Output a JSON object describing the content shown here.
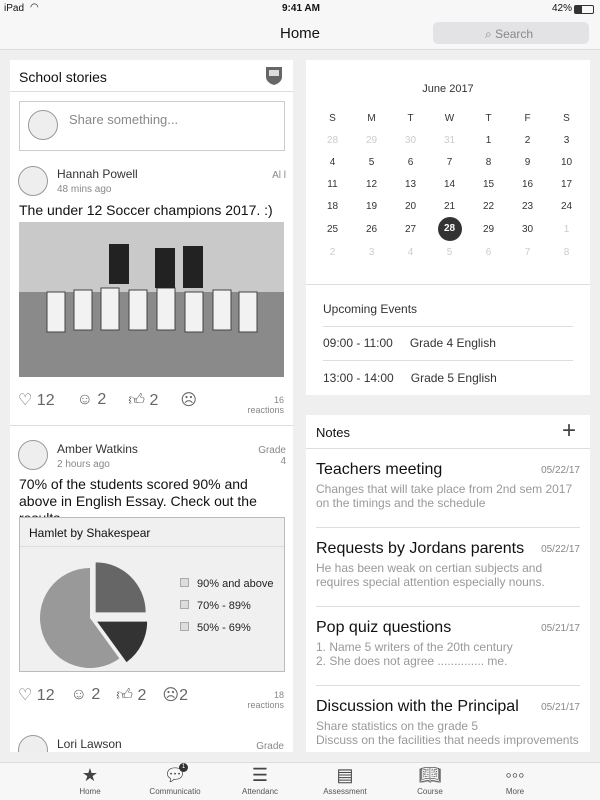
{
  "status": {
    "device": "iPad",
    "time": "9:41 AM",
    "battery": "42%"
  },
  "nav": {
    "title": "Home",
    "search_placeholder": "Search"
  },
  "stories": {
    "title": "School stories",
    "share_placeholder": "Share something...",
    "posts": [
      {
        "author": "Hannah Powell",
        "time": "48 mins ago",
        "audience": "Al l",
        "text": "The under 12 Soccer champions 2017. :)",
        "reactions": {
          "love": "12",
          "smile": "2",
          "like": "2",
          "sad": ""
        },
        "total": "16",
        "total_label": "reactions"
      },
      {
        "author": "Amber Watkins",
        "time": "2 hours ago",
        "audience": "Grade 4",
        "text": "70% of the students scored 90% and above in English Essay. Check out the results",
        "reactions": {
          "love": "12",
          "smile": "2",
          "like": "2",
          "sad": "2"
        },
        "total": "18",
        "total_label": "reactions",
        "chart": {
          "title": "Hamlet by Shakespear",
          "legend": [
            "90% and above",
            "70% - 89%",
            "50% - 69%"
          ],
          "slices": [
            25,
            15,
            60
          ],
          "colors": [
            "#666666",
            "#333333",
            "#999999"
          ]
        }
      },
      {
        "author": "Lori Lawson",
        "audience": "Grade"
      }
    ]
  },
  "calendar": {
    "month": "June 2017",
    "weekdays": [
      "S",
      "M",
      "T",
      "W",
      "T",
      "F",
      "S"
    ],
    "weeks": [
      [
        "28",
        "29",
        "30",
        "31",
        "1",
        "2",
        "3"
      ],
      [
        "4",
        "5",
        "6",
        "7",
        "8",
        "9",
        "10"
      ],
      [
        "11",
        "12",
        "13",
        "14",
        "15",
        "16",
        "17"
      ],
      [
        "18",
        "19",
        "20",
        "21",
        "22",
        "23",
        "24"
      ],
      [
        "25",
        "26",
        "27",
        "28",
        "29",
        "30",
        "1"
      ],
      [
        "2",
        "3",
        "4",
        "5",
        "6",
        "7",
        "8"
      ]
    ],
    "selected": "28",
    "events_title": "Upcoming Events",
    "events": [
      {
        "time": "09:00 - 11:00",
        "title": "Grade 4 English"
      },
      {
        "time": "13:00 - 14:00",
        "title": "Grade 5 English"
      }
    ]
  },
  "notes": {
    "title": "Notes",
    "items": [
      {
        "title": "Teachers meeting",
        "date": "05/22/17",
        "body": "Changes that will take place from 2nd sem 2017 on the timings and the schedule"
      },
      {
        "title": "Requests by Jordans parents",
        "date": "05/22/17",
        "body": "He has been weak on certian subjects and requires special attention especially nouns."
      },
      {
        "title": "Pop quiz questions",
        "date": "05/21/17",
        "body": "1. Name 5 writers of the 20th century\n2. She does not agree .............. me."
      },
      {
        "title": "Discussion with the Principal",
        "date": "05/21/17",
        "body": "Share statistics on the grade 5\nDiscuss on the facilities that needs improvements"
      }
    ]
  },
  "tabs": [
    {
      "label": "Home",
      "icon": "star-icon"
    },
    {
      "label": "Communicatio",
      "icon": "chat-icon",
      "badge": "1"
    },
    {
      "label": "Attendanc",
      "icon": "list-icon"
    },
    {
      "label": "Assessment",
      "icon": "assessment-icon"
    },
    {
      "label": "Course",
      "icon": "book-icon"
    },
    {
      "label": "More",
      "icon": "more-icon"
    }
  ]
}
